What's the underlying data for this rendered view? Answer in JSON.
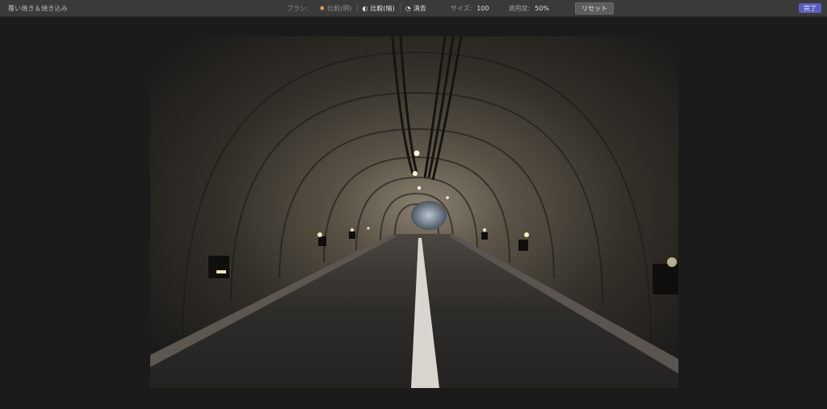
{
  "toolbar": {
    "title": "覆い焼き＆焼き込み",
    "brush_label": "ブラシ:",
    "compare_bright_label": "比較(明)",
    "compare_dark_label": "比較(暗)",
    "erase_label": "消去",
    "size_label": "サイズ:",
    "size_value": "100",
    "strength_label": "適用度:",
    "strength_value": "50%",
    "reset_label": "リセット",
    "done_label": "完了"
  },
  "colors": {
    "accent_button": "#5a5fbf",
    "brush_active": "#e6a93a"
  },
  "image": {
    "subject": "tunnel-photo"
  }
}
